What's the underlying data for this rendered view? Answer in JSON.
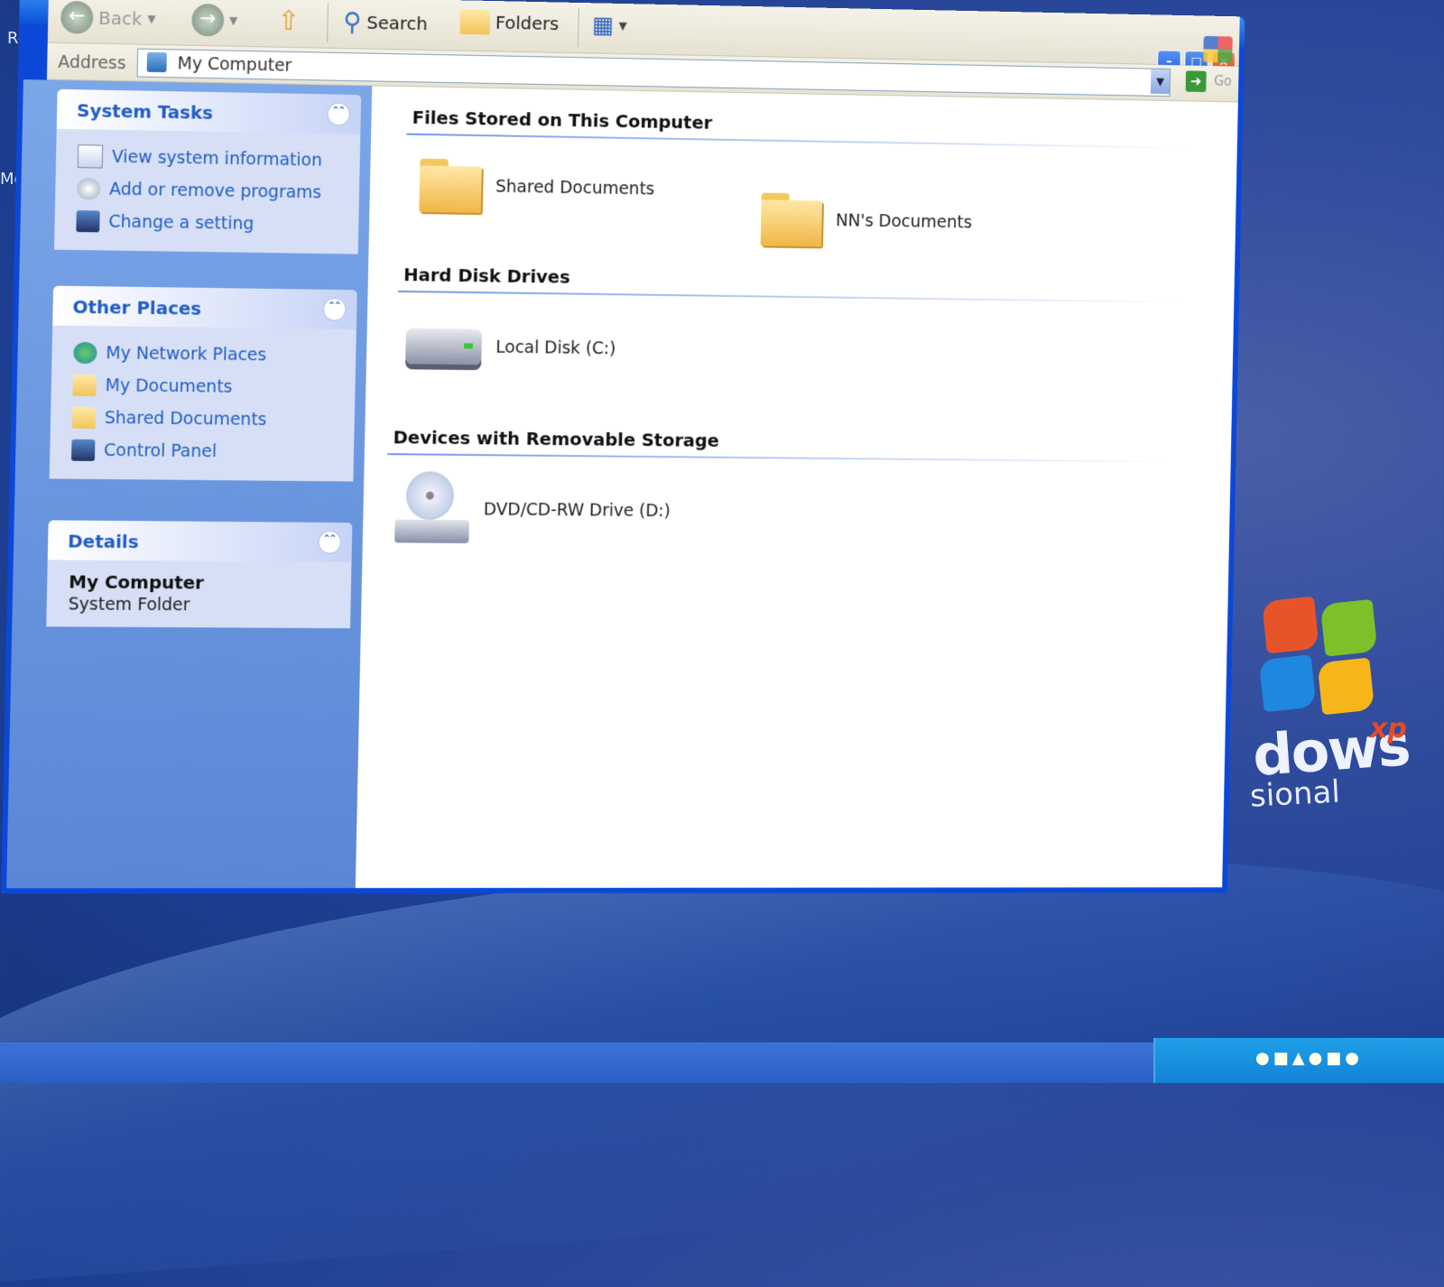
{
  "desktop": {
    "icon_label_top": "Rec",
    "icon_label_mid": "Mozill",
    "brand_word": "dows",
    "brand_sup": "xp",
    "brand_sub": "sional"
  },
  "window": {
    "toolbar": {
      "back_label": "Back",
      "search_label": "Search",
      "folders_label": "Folders"
    },
    "address": {
      "label": "Address",
      "value": "My Computer",
      "go_label": "Go"
    }
  },
  "left_pane": {
    "system_tasks": {
      "title": "System Tasks",
      "items": [
        {
          "label": "View system information",
          "icon": "system-info-icon"
        },
        {
          "label": "Add or remove programs",
          "icon": "add-remove-icon"
        },
        {
          "label": "Change a setting",
          "icon": "control-panel-icon"
        }
      ]
    },
    "other_places": {
      "title": "Other Places",
      "items": [
        {
          "label": "My Network Places",
          "icon": "network-places-icon"
        },
        {
          "label": "My Documents",
          "icon": "folder-icon"
        },
        {
          "label": "Shared Documents",
          "icon": "folder-icon"
        },
        {
          "label": "Control Panel",
          "icon": "control-panel-icon"
        }
      ]
    },
    "details": {
      "title": "Details",
      "name": "My Computer",
      "type": "System Folder"
    }
  },
  "content": {
    "files_stored": {
      "title": "Files Stored on This Computer",
      "items": [
        "Shared Documents",
        "NN's Documents"
      ]
    },
    "hard_disks": {
      "title": "Hard Disk Drives",
      "items": [
        "Local Disk (C:)"
      ]
    },
    "removable": {
      "title": "Devices with Removable Storage",
      "items": [
        "DVD/CD-RW Drive (D:)"
      ]
    }
  },
  "colors": {
    "link_blue": "#215dc6",
    "pane_blue": "#6b96de",
    "title_blue": "#0a52d8"
  }
}
